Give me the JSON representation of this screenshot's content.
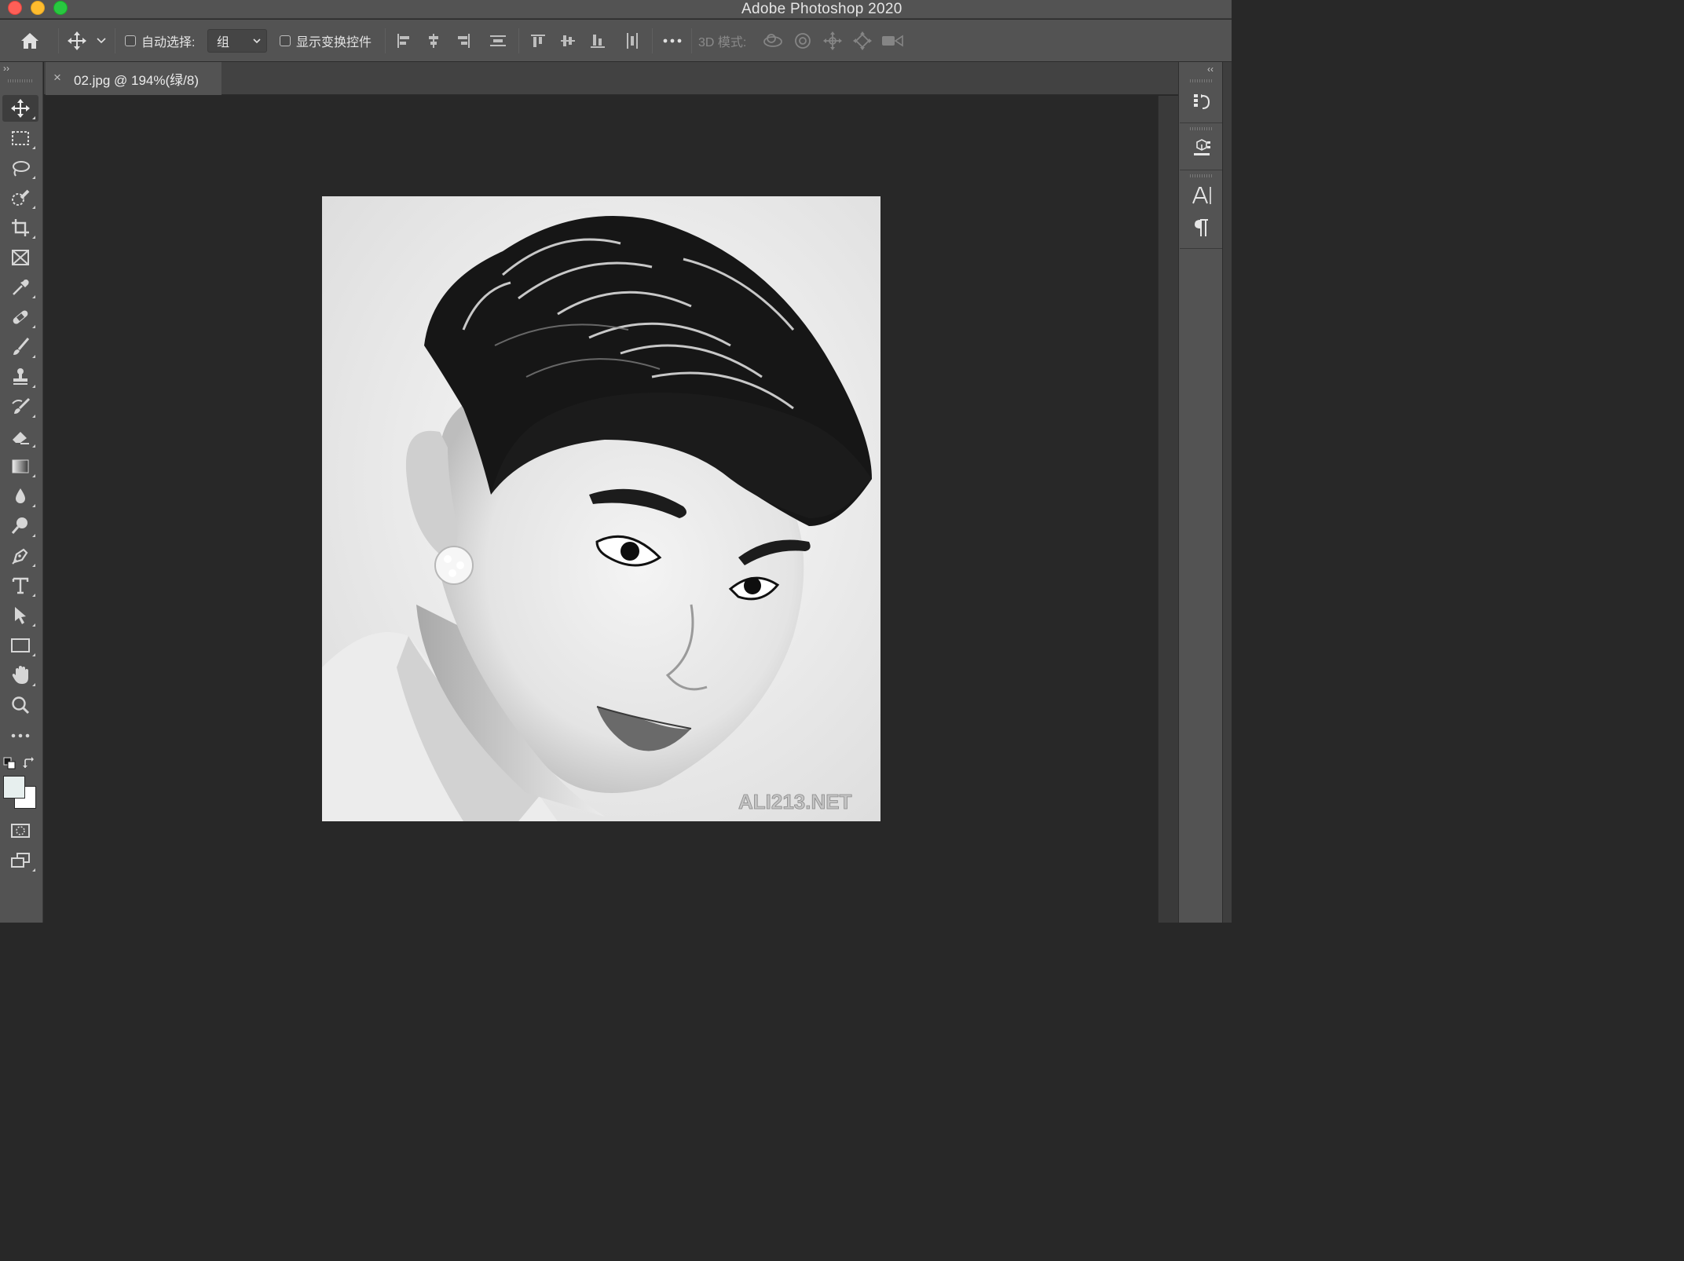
{
  "window": {
    "app_title": "Adobe Photoshop 2020"
  },
  "options_bar": {
    "auto_select_label": "自动选择:",
    "auto_select_checked": false,
    "auto_select_mode": "组",
    "show_transform_label": "显示变换控件",
    "show_transform_checked": false,
    "mode_3d_label": "3D 模式:"
  },
  "document": {
    "tab_close": "×",
    "tab_title": "02.jpg @ 194%(绿/8)"
  },
  "photo": {
    "watermark": "ALI213.NET"
  },
  "colors": {
    "foreground": "#e7efee",
    "background": "#ffffff",
    "ui_panel": "#535353",
    "canvas_bg": "#282828"
  },
  "tools": [
    "move-tool",
    "rectangular-marquee-tool",
    "lasso-tool",
    "quick-selection-tool",
    "crop-tool",
    "frame-tool",
    "eyedropper-tool",
    "healing-brush-tool",
    "brush-tool",
    "clone-stamp-tool",
    "history-brush-tool",
    "eraser-tool",
    "gradient-tool",
    "blur-tool",
    "dodge-tool",
    "pen-tool",
    "type-tool",
    "path-selection-tool",
    "rectangle-tool",
    "hand-tool",
    "zoom-tool",
    "edit-toolbar"
  ]
}
